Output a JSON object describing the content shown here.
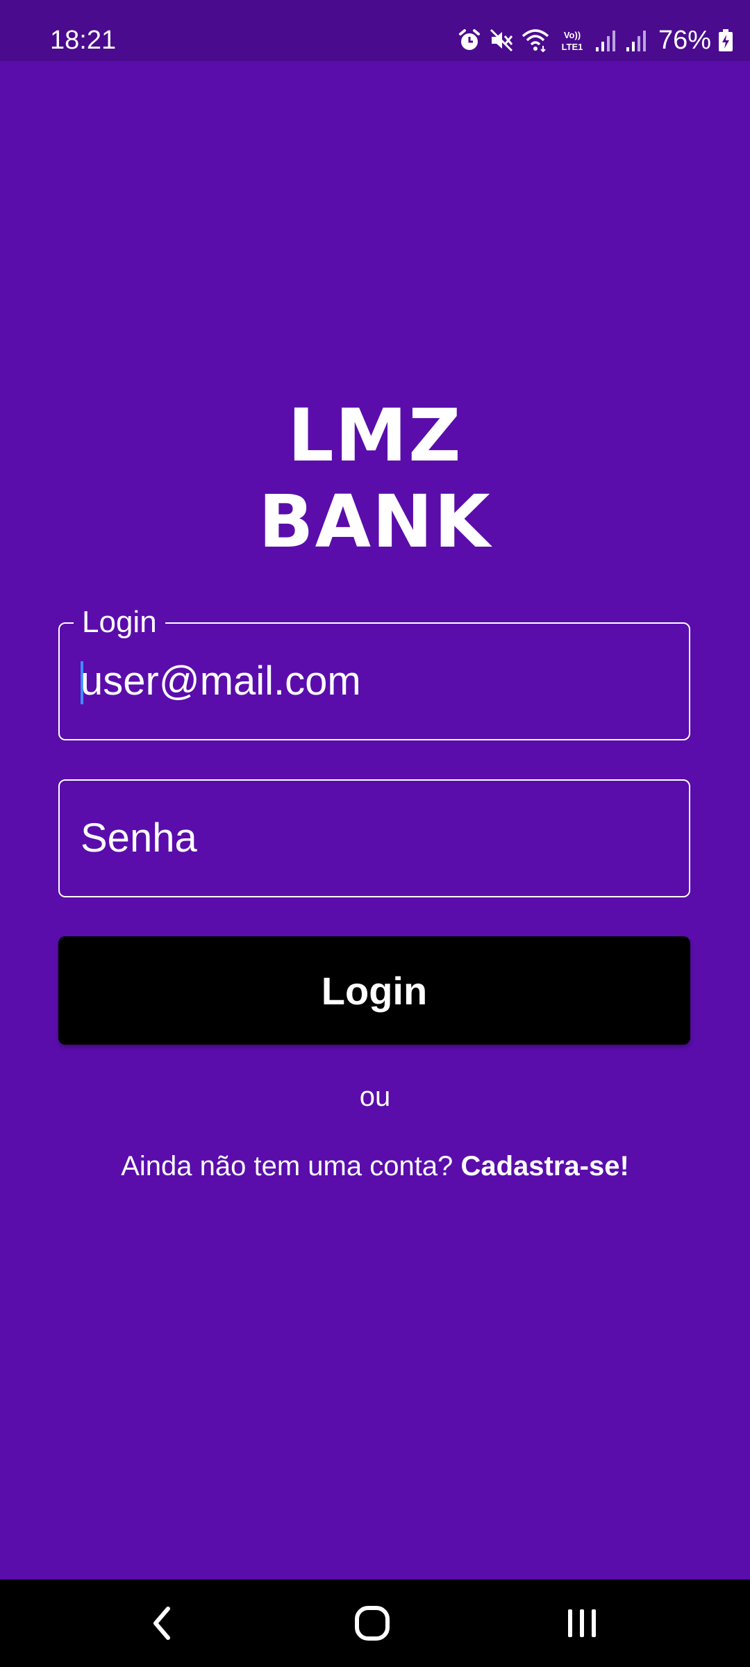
{
  "status_bar": {
    "time": "18:21",
    "battery": "76%",
    "network_label": "Vo)) LTE1",
    "icons": [
      "alarm-icon",
      "mute-icon",
      "wifi-icon",
      "volte-icon",
      "signal-icon",
      "signal-icon",
      "battery-charging-icon"
    ]
  },
  "logo": {
    "line1": "LMZ",
    "line2": "BANK"
  },
  "login_field": {
    "label": "Login",
    "value": "user@mail.com"
  },
  "password_field": {
    "placeholder": "Senha"
  },
  "login_button": {
    "label": "Login"
  },
  "divider_text": "ou",
  "signup": {
    "prompt": "Ainda não tem uma conta?",
    "link": "Cadastra-se!"
  },
  "nav_bar": {
    "icons": [
      "back-icon",
      "home-icon",
      "recents-icon"
    ]
  },
  "colors": {
    "background": "#5a0dab",
    "status_bar": "#4a0b8e",
    "button": "#000000",
    "text": "#ffffff",
    "caret": "#3c8dff"
  }
}
